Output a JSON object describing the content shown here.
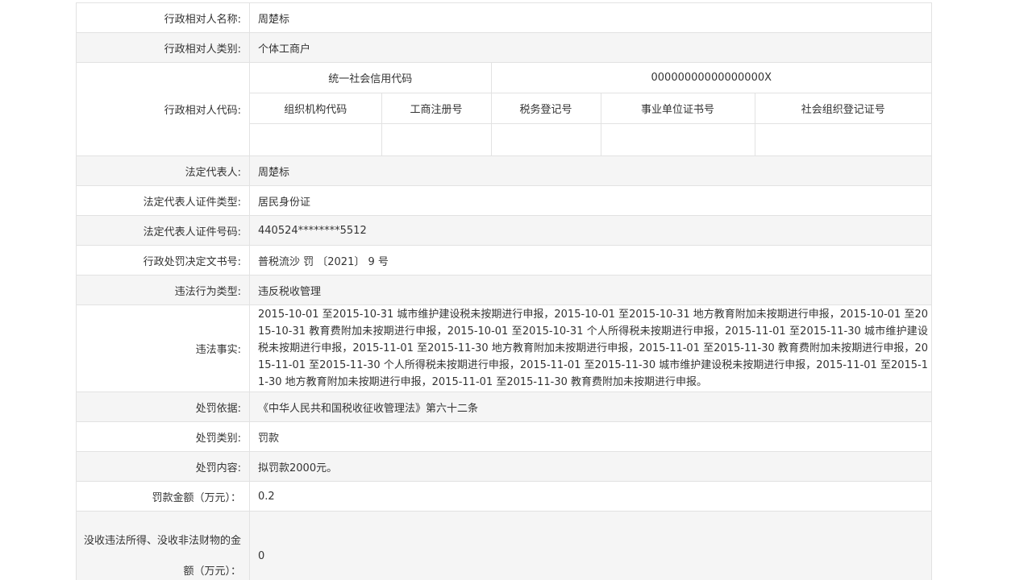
{
  "rows": {
    "name": {
      "label": "行政相对人名称:",
      "value": "周楚标"
    },
    "category": {
      "label": "行政相对人类别:",
      "value": "个体工商户"
    },
    "code": {
      "label": "行政相对人代码:",
      "unified_label": "统一社会信用代码",
      "unified_value": "00000000000000000X",
      "headers": [
        "组织机构代码",
        "工商注册号",
        "税务登记号",
        "事业单位证书号",
        "社会组织登记证号"
      ],
      "values": [
        "",
        "",
        "",
        "",
        ""
      ]
    },
    "legal_rep": {
      "label": "法定代表人:",
      "value": "周楚标"
    },
    "id_type": {
      "label": "法定代表人证件类型:",
      "value": "居民身份证"
    },
    "id_number": {
      "label": "法定代表人证件号码:",
      "value": "440524********5512"
    },
    "decision_no": {
      "label": "行政处罚决定文书号:",
      "value": "普税流沙 罚 〔2021〕 9 号"
    },
    "violation_type": {
      "label": "违法行为类型:",
      "value": "违反税收管理"
    },
    "violation_facts": {
      "label": "违法事实:",
      "value": "2015-10-01 至2015-10-31 城市维护建设税未按期进行申报，2015-10-01 至2015-10-31 地方教育附加未按期进行申报，2015-10-01 至2015-10-31 教育费附加未按期进行申报，2015-10-01 至2015-10-31 个人所得税未按期进行申报，2015-11-01 至2015-11-30 城市维护建设税未按期进行申报，2015-11-01 至2015-11-30 地方教育附加未按期进行申报，2015-11-01 至2015-11-30 教育费附加未按期进行申报，2015-11-01 至2015-11-30 个人所得税未按期进行申报，2015-11-01 至2015-11-30 城市维护建设税未按期进行申报，2015-11-01 至2015-11-30 地方教育附加未按期进行申报，2015-11-01 至2015-11-30 教育费附加未按期进行申报。"
    },
    "basis": {
      "label": "处罚依据:",
      "value": "《中华人民共和国税收征收管理法》第六十二条"
    },
    "penalty_category": {
      "label": "处罚类别:",
      "value": "罚款"
    },
    "penalty_content": {
      "label": "处罚内容:",
      "value": "拟罚款2000元。"
    },
    "fine_amount": {
      "label": "罚款金额（万元）：",
      "value": "0.2"
    },
    "confiscation": {
      "label": "没收违法所得、没收非法财物的金额（万元）：",
      "value": "0"
    }
  }
}
